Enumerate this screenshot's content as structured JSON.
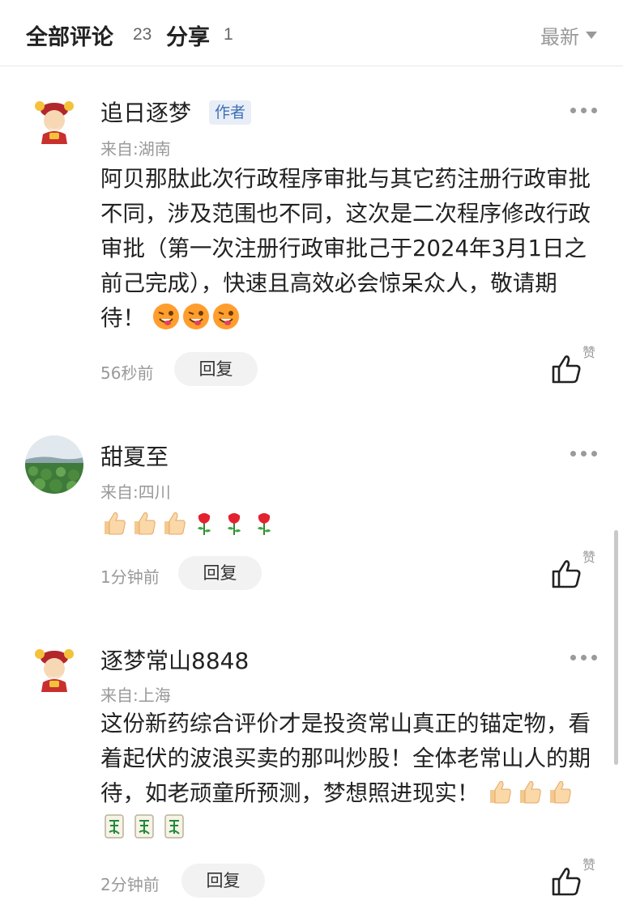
{
  "header": {
    "title": "全部评论",
    "comment_count": "23",
    "share_label": "分享",
    "share_count": "1",
    "sort_label": "最新"
  },
  "comments": [
    {
      "name": "追日逐梦",
      "badge": "作者",
      "location": "来自:湖南",
      "text": "阿贝那肽此次行政程序审批与其它药注册行政审批不同，涉及范围也不同，这次是二次程序修改行政审批（第一次注册行政审批己于2024年3月1日之前己完成），快速且高效必会惊呆众人，敬请期待！",
      "emojis": [
        "wink-tongue-emoji",
        "wink-tongue-emoji",
        "wink-tongue-emoji"
      ],
      "time": "56秒前",
      "reply_label": "回复",
      "like_label": "赞"
    },
    {
      "name": "甜夏至",
      "location": "来自:四川",
      "text": "",
      "emojis": [
        "thumbs-up-emoji",
        "thumbs-up-emoji",
        "thumbs-up-emoji",
        "rose-emoji",
        "rose-emoji",
        "rose-emoji"
      ],
      "time": "1分钟前",
      "reply_label": "回复",
      "like_label": "赞"
    },
    {
      "name": "逐梦常山8848",
      "location": "来自:上海",
      "text": "这份新药综合评价才是投资常山真正的锚定物，看着起伏的波浪买卖的那叫炒股！全体老常山人的期待，如老顽童所预测，梦想照进现实！",
      "emojis": [
        "thumbs-up-emoji",
        "thumbs-up-emoji",
        "thumbs-up-emoji",
        "mahjong-fa-emoji",
        "mahjong-fa-emoji",
        "mahjong-fa-emoji"
      ],
      "time": "2分钟前",
      "reply_label": "回复",
      "like_label": "赞"
    }
  ]
}
